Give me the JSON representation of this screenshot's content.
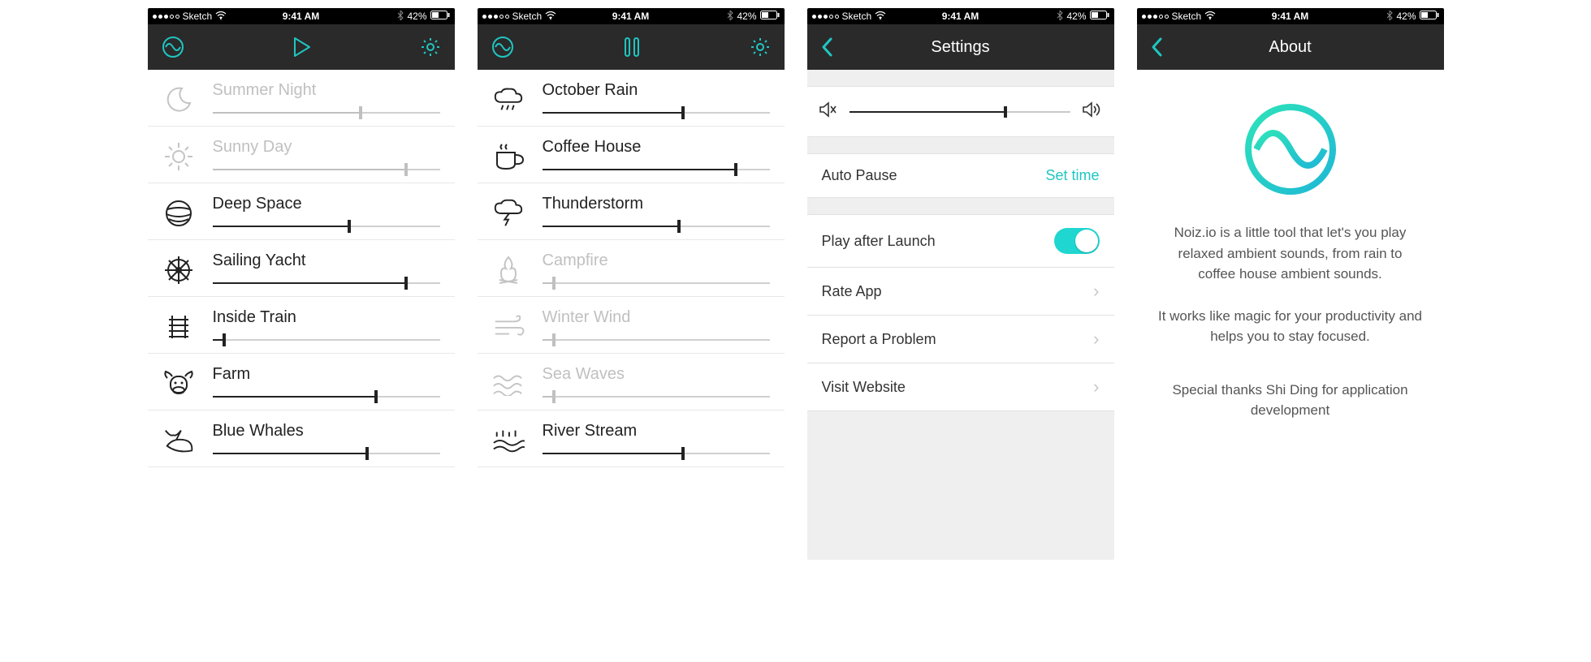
{
  "status": {
    "carrier": "Sketch",
    "time": "9:41 AM",
    "battery": "42%"
  },
  "accent": "#1fc6c2",
  "screens": [
    {
      "state": "paused",
      "sounds": [
        {
          "name": "Summer Night",
          "icon": "moon",
          "active": false,
          "value": 65
        },
        {
          "name": "Sunny Day",
          "icon": "sun",
          "active": false,
          "value": 85
        },
        {
          "name": "Deep Space",
          "icon": "planet",
          "active": true,
          "value": 60
        },
        {
          "name": "Sailing Yacht",
          "icon": "wheel",
          "active": true,
          "value": 85
        },
        {
          "name": "Inside Train",
          "icon": "tracks",
          "active": true,
          "value": 5
        },
        {
          "name": "Farm",
          "icon": "cow",
          "active": true,
          "value": 72
        },
        {
          "name": "Blue Whales",
          "icon": "whale",
          "active": true,
          "value": 68
        }
      ]
    },
    {
      "state": "playing",
      "sounds": [
        {
          "name": "October Rain",
          "icon": "cloud-rain",
          "active": true,
          "value": 62
        },
        {
          "name": "Coffee House",
          "icon": "cup",
          "active": true,
          "value": 85
        },
        {
          "name": "Thunderstorm",
          "icon": "cloud-bolt",
          "active": true,
          "value": 60
        },
        {
          "name": "Campfire",
          "icon": "fire",
          "active": false,
          "value": 5
        },
        {
          "name": "Winter Wind",
          "icon": "wind",
          "active": false,
          "value": 5
        },
        {
          "name": "Sea Waves",
          "icon": "waves",
          "active": false,
          "value": 5
        },
        {
          "name": "River Stream",
          "icon": "river",
          "active": true,
          "value": 62
        }
      ]
    }
  ],
  "settings": {
    "title": "Settings",
    "volume": 70,
    "autoPause": {
      "label": "Auto Pause",
      "action": "Set time"
    },
    "playAfterLaunch": {
      "label": "Play after Launch",
      "on": true
    },
    "items": [
      {
        "label": "Rate App"
      },
      {
        "label": "Report a Problem"
      },
      {
        "label": "Visit Website"
      }
    ]
  },
  "about": {
    "title": "About",
    "p1": "Noiz.io is a little tool that let's you play relaxed ambient sounds, from rain to coffee house ambient sounds.",
    "p2": "It works like magic for your productivity and helps you to stay focused.",
    "p3": "Special thanks Shi Ding for application development"
  }
}
